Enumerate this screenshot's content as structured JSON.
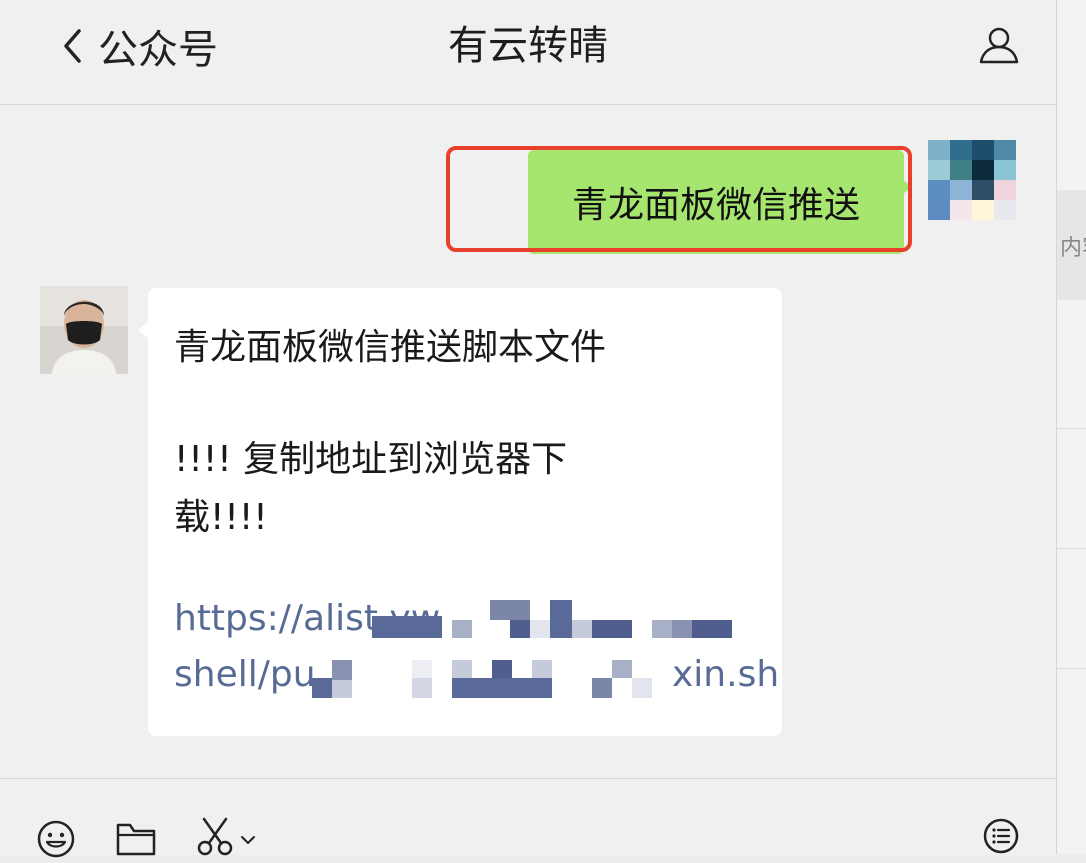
{
  "header": {
    "back_label": "公众号",
    "title": "有云转晴"
  },
  "messages": {
    "sent_text": "青龙面板微信推送",
    "received": {
      "line1": "青龙面板微信推送脚本文件",
      "line2": "!!!! 复制地址到浏览器下",
      "line3": "载!!!!",
      "link_line1": "https://alist.yw",
      "link_line2_start": "shell/pu",
      "link_line2_end": "xin.sh"
    }
  },
  "side_panel": {
    "partial_text": "内容"
  },
  "colors": {
    "sent_bubble": "#a6e66f",
    "highlight": "#e8402c",
    "link": "#576b95"
  },
  "icons": [
    "back-icon",
    "profile-icon",
    "emoji-icon",
    "folder-icon",
    "scissors-icon",
    "chevron-down-icon",
    "list-icon"
  ]
}
